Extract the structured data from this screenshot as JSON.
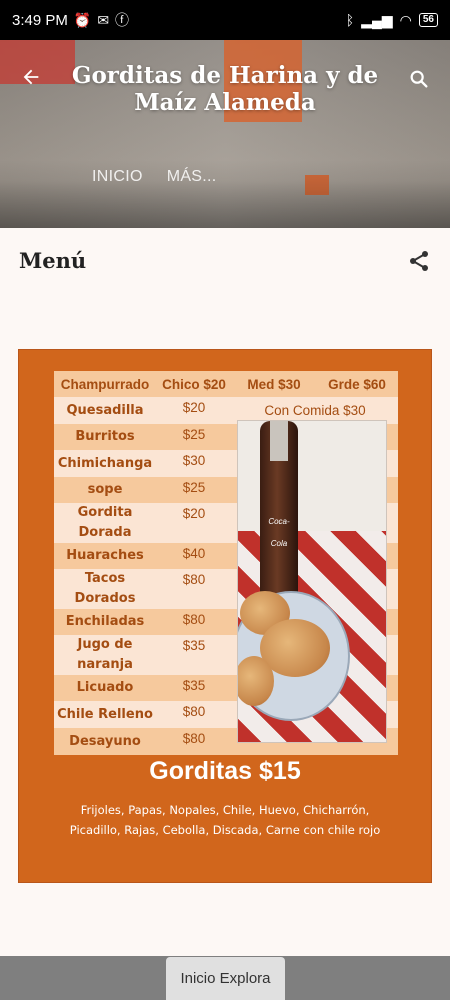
{
  "status_bar": {
    "time": "3:49 PM",
    "battery": "56",
    "left_icons": [
      "alarm-icon",
      "gmail-icon",
      "facebook-icon"
    ],
    "right_icons": [
      "bluetooth-icon",
      "signal-icon",
      "wifi-icon",
      "battery-icon"
    ]
  },
  "header": {
    "title": "Gorditas de Harina y de Maíz Alameda",
    "tabs": [
      {
        "label": "INICIO"
      },
      {
        "label": "MÁS..."
      }
    ]
  },
  "main": {
    "page_title": "Menú"
  },
  "menu_image": {
    "headers": [
      "Champurrado",
      "Chico $20",
      "Med $30",
      "Grde $60"
    ],
    "items": [
      {
        "name": "Quesadilla",
        "price": "$20",
        "extra": "Con Comida $30"
      },
      {
        "name": "Burritos",
        "price": "$25"
      },
      {
        "name": "Chimichanga",
        "price": "$30"
      },
      {
        "name": "sope",
        "price": "$25"
      },
      {
        "name": "Gordita Dorada",
        "price": "$20"
      },
      {
        "name": "Huaraches",
        "price": "$40"
      },
      {
        "name": "Tacos Dorados",
        "price": "$80"
      },
      {
        "name": "Enchiladas",
        "price": "$80"
      },
      {
        "name": "Jugo de naranja",
        "price": "$35"
      },
      {
        "name": "Licuado",
        "price": "$35"
      },
      {
        "name": "Chile Relleno",
        "price": "$80"
      },
      {
        "name": "Desayuno",
        "price": "$80"
      }
    ],
    "photo_label": "Coca-Cola",
    "gorditas_title": "Gorditas $15",
    "fillings_line1": "Frijoles, Papas, Nopales, Chile, Huevo, Chicharrón,",
    "fillings_line2": "Picadillo, Rajas, Cebolla, Discada, Carne con chile rojo"
  },
  "footer": {
    "explore_label": "Inicio Explora"
  },
  "colors": {
    "menu_background": "#d1661c",
    "row_light": "#fbe5d4",
    "row_dark": "#f6c99d",
    "text_orange": "#a44d12"
  }
}
